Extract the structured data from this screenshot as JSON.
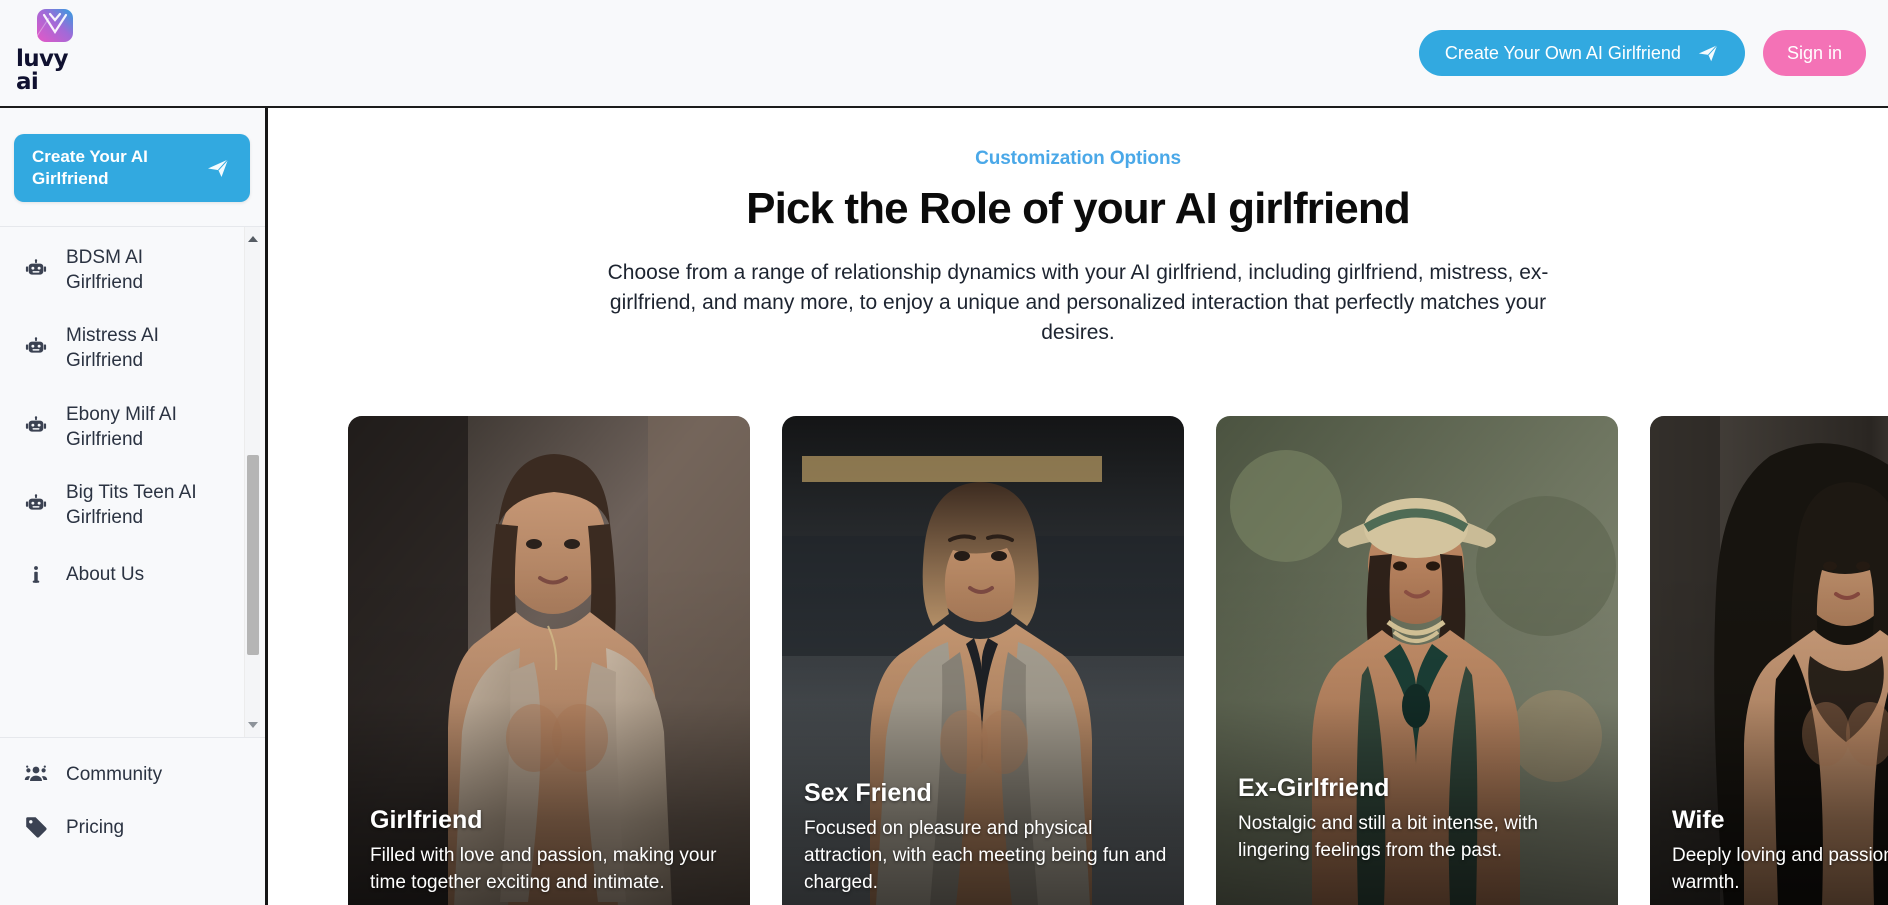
{
  "brand": {
    "name": "luvy ai",
    "logo_icon": "heart-v-gradient-logo",
    "gradient_from": "#e060c8",
    "gradient_to": "#2f9fe0"
  },
  "header": {
    "create_button": {
      "label": "Create Your Own AI Girlfriend",
      "icon": "send-icon",
      "color": "#32a9e0"
    },
    "signin_button": {
      "label": "Sign in",
      "color": "#f472b6"
    }
  },
  "sidebar": {
    "create_button": {
      "label": "Create Your AI Girlfriend",
      "icon": "send-icon",
      "color": "#32a9e0"
    },
    "scroll_items": [
      {
        "label": "BDSM AI Girlfriend",
        "icon": "robot-icon"
      },
      {
        "label": "Mistress AI Girlfriend",
        "icon": "robot-icon"
      },
      {
        "label": "Ebony Milf AI Girlfriend",
        "icon": "robot-icon"
      },
      {
        "label": "Big Tits Teen AI Girlfriend",
        "icon": "robot-icon"
      },
      {
        "label": "About Us",
        "icon": "info-icon"
      }
    ],
    "bottom_items": [
      {
        "label": "Community",
        "icon": "people-icon"
      },
      {
        "label": "Pricing",
        "icon": "tag-icon"
      }
    ],
    "scrollbar": {
      "up_arrow_icon": "chevron-up-icon",
      "down_arrow_icon": "chevron-down-icon"
    }
  },
  "main": {
    "eyebrow": "Customization Options",
    "eyebrow_color": "#4aa8e8",
    "title": "Pick the Role of your AI girlfriend",
    "description": "Choose from a range of relationship dynamics with your AI girlfriend, including girlfriend, mistress, ex-girlfriend, and many more, to enjoy a unique and personalized interaction that perfectly matches your desires.",
    "cards": [
      {
        "title": "Girlfriend",
        "description": "Filled with love and passion, making your time together exciting and intimate.",
        "image_alt": "woman in beige leather jacket on a city street"
      },
      {
        "title": "Sex Friend",
        "description": "Focused on pleasure and physical attraction, with each meeting being fun and charged.",
        "image_alt": "woman with bob haircut in grey blazer indoors"
      },
      {
        "title": "Ex-Girlfriend",
        "description": "Nostalgic and still a bit intense, with lingering feelings from the past.",
        "image_alt": "woman in straw hat and green top outdoors"
      },
      {
        "title": "Wife",
        "description": "Deeply loving and passionate, with lots of warmth.",
        "image_alt": "woman in dark lace outfit by a window"
      }
    ]
  }
}
